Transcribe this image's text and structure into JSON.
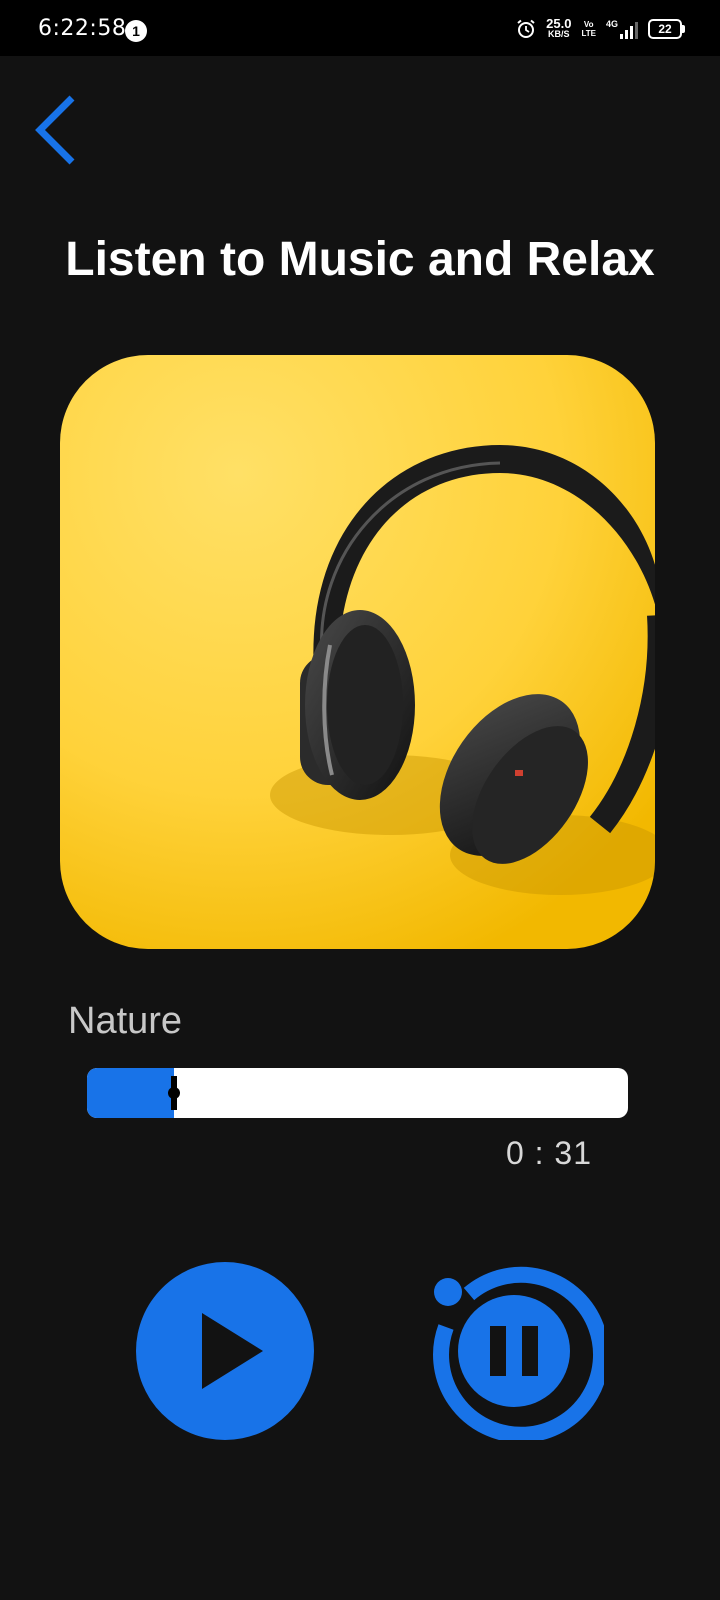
{
  "status_bar": {
    "time": "6:22:58",
    "notification_count": "1",
    "net_speed_value": "25.0",
    "net_speed_unit": "KB/S",
    "volte_top": "Vo",
    "volte_bottom": "LTE",
    "network_type": "4G",
    "battery": "22"
  },
  "player": {
    "title": "Listen to Music and Relax",
    "track_name": "Nature",
    "elapsed": "0 : 31",
    "progress_fraction": 0.16
  },
  "colors": {
    "accent": "#1873e8",
    "background": "#121212",
    "cover_yellow": "#ffcf2e"
  },
  "icons": {
    "back": "chevron-left-icon",
    "play": "play-icon",
    "pause": "pause-icon",
    "alarm": "alarm-clock-icon"
  }
}
